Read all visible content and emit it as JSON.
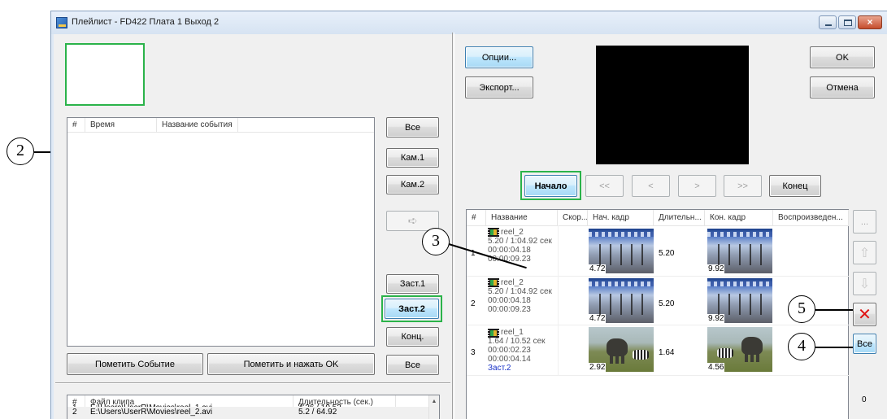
{
  "window": {
    "title": "Плейлист - FD422 Плата 1 Выход 2"
  },
  "callouts": [
    "2",
    "3",
    "5",
    "4"
  ],
  "events": {
    "columns": [
      "#",
      "Время",
      "Название события"
    ]
  },
  "event_buttons": {
    "all_top": "Все",
    "cam1": "Кам.1",
    "cam2": "Кам.2",
    "zast1": "Заст.1",
    "zast2": "Заст.2",
    "konc": "Конц.",
    "all_bottom": "Все"
  },
  "mark_event": "Пометить Событие",
  "mark_and_ok": "Пометить и нажать OK",
  "files": {
    "columns": [
      "#",
      "Файл клипа",
      "Длительность (сек.)"
    ],
    "rows": [
      {
        "n": "1",
        "file": "E:\\Users\\UserR\\Movies\\reel_1.avi",
        "duration": "4.36 / 10.52"
      },
      {
        "n": "2",
        "file": "E:\\Users\\UserR\\Movies\\reel_2.avi",
        "duration": "5.2 / 64.92"
      }
    ]
  },
  "right": {
    "options": "Опции...",
    "export": "Экспорт...",
    "ok": "OK",
    "cancel": "Отмена",
    "nav": {
      "start": "Начало",
      "rewind": "<<",
      "prev": "<",
      "next": ">",
      "forward": ">>",
      "end": "Конец"
    },
    "side": {
      "more": "...",
      "all": "Все",
      "counter": "0"
    }
  },
  "playlist": {
    "columns": [
      "#",
      "Название",
      "Скор...",
      "Нач. кадр",
      "Длительн...",
      "Кон. кадр",
      "Воспроизведен..."
    ],
    "rows": [
      {
        "n": "1",
        "name": "reel_2",
        "l1": "5.20 / 1:04.92 сек",
        "l2": "00:00:04.18",
        "l3": "00:00:09.23",
        "l4": "",
        "start_label": "4.72",
        "duration": "5.20",
        "end_label": "9.92"
      },
      {
        "n": "2",
        "name": "reel_2",
        "l1": "5.20 / 1:04.92 сек",
        "l2": "00:00:04.18",
        "l3": "00:00:09.23",
        "l4": "",
        "start_label": "4.72",
        "duration": "5.20",
        "end_label": "9.92"
      },
      {
        "n": "3",
        "name": "reel_1",
        "l1": "1.64 / 10.52 сек",
        "l2": "00:00:02.23",
        "l3": "00:00:04.14",
        "l4": "Заст.2",
        "start_label": "2.92",
        "duration": "1.64",
        "end_label": "4.56"
      }
    ]
  }
}
